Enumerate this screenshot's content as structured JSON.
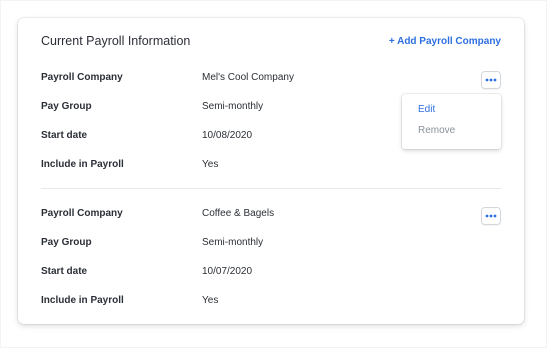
{
  "card": {
    "title": "Current Payroll Information",
    "add_link": "+ Add Payroll Company"
  },
  "entries": [
    {
      "rows": [
        {
          "label": "Payroll Company",
          "value": "Mel's Cool Company"
        },
        {
          "label": "Pay Group",
          "value": "Semi-monthly"
        },
        {
          "label": "Start date",
          "value": "10/08/2020"
        },
        {
          "label": "Include in Payroll",
          "value": "Yes"
        }
      ]
    },
    {
      "rows": [
        {
          "label": "Payroll Company",
          "value": "Coffee & Bagels"
        },
        {
          "label": "Pay Group",
          "value": "Semi-monthly"
        },
        {
          "label": "Start date",
          "value": "10/07/2020"
        },
        {
          "label": "Include in Payroll",
          "value": "Yes"
        }
      ]
    }
  ],
  "menu": {
    "edit": "Edit",
    "remove": "Remove"
  },
  "icons": {
    "more_button": "more-horizontal-icon"
  },
  "colors": {
    "accent": "#2d6fe0",
    "text": "#2b2f36",
    "muted": "#8a9099"
  }
}
